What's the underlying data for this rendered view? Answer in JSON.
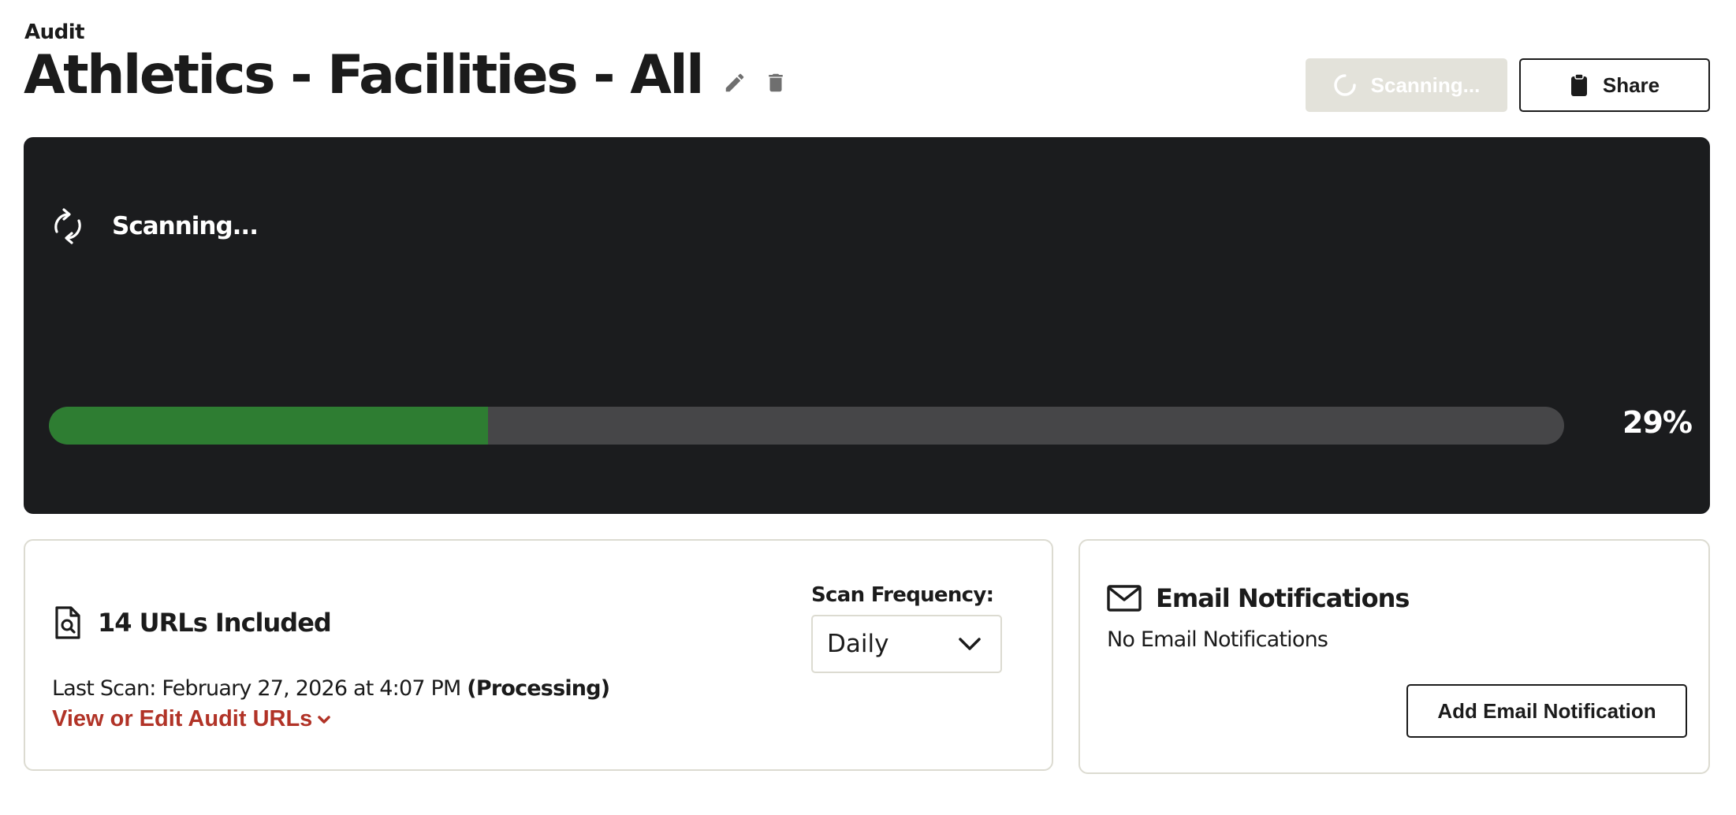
{
  "header": {
    "eyebrow": "Audit",
    "title": "Athletics - Facilities - All",
    "scan_button_label": "Scanning...",
    "share_button_label": "Share"
  },
  "status": {
    "label": "Scanning...",
    "progress_percent": 29,
    "progress_label": "29%"
  },
  "urls_card": {
    "title": "14 URLs Included",
    "last_scan_prefix": "Last Scan: February 27, 2026 at 4:07 PM",
    "last_scan_status": "(Processing)",
    "edit_link_label": "View or Edit Audit URLs",
    "frequency_label": "Scan Frequency:",
    "frequency_value": "Daily"
  },
  "email_card": {
    "title": "Email Notifications",
    "empty_text": "No Email Notifications",
    "add_button_label": "Add Email Notification"
  },
  "colors": {
    "accent_link": "#b13327",
    "progress_fill": "#2e7d32",
    "panel_background": "#1b1c1e"
  },
  "icons": {
    "edit": "pencil-icon",
    "delete": "trash-icon",
    "scan_spinner": "spinner-icon",
    "share": "clipboard-icon",
    "status": "refresh-icon",
    "urls": "document-search-icon",
    "email": "envelope-icon",
    "select": "chevron-down-icon",
    "link": "chevron-down-icon"
  }
}
